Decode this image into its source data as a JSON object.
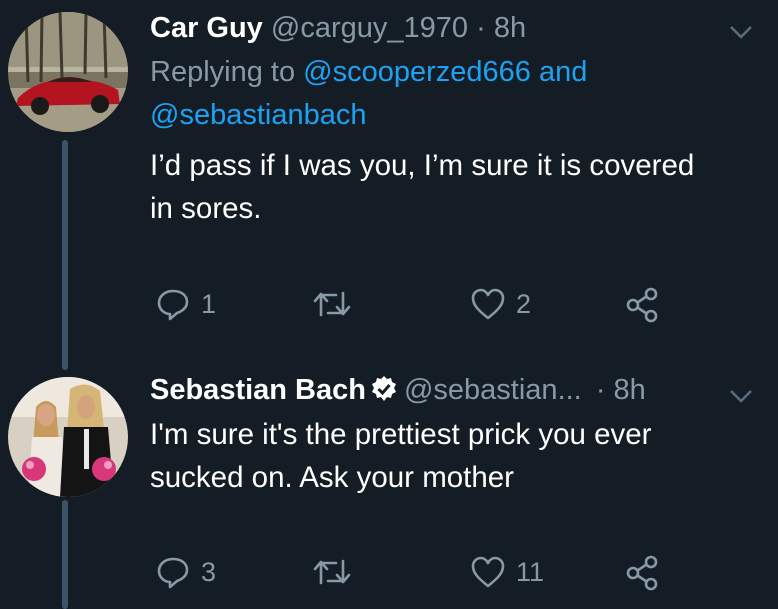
{
  "tweets": [
    {
      "name": "Car Guy",
      "handle": "@carguy_1970",
      "separator": "·",
      "time": "8h",
      "replying_prefix": "Replying to",
      "reply_user1": "@scooperzed666",
      "reply_and": "and",
      "reply_user2": "@sebastianbach",
      "text_line1": "I’d pass if I was you, I’m sure it is covered",
      "text_line2": "in sores.",
      "reply_count": "1",
      "retweet_count": "",
      "like_count": "2",
      "avatar_icon": "red-sports-car-photo"
    },
    {
      "name": "Sebastian Bach",
      "verified": true,
      "handle": "@sebastian...",
      "separator": "·",
      "time": "8h",
      "text_line1": "I'm sure it's the prettiest prick you ever",
      "text_line2": "sucked on. Ask your mother",
      "reply_count": "3",
      "retweet_count": "",
      "like_count": "11",
      "avatar_icon": "couple-photo"
    }
  ],
  "icons": {
    "reply": "reply-icon",
    "retweet": "retweet-icon",
    "like": "heart-icon",
    "share": "share-icon",
    "caret": "chevron-down-icon",
    "verified": "verified-badge-icon"
  },
  "colors": {
    "background": "#141d26",
    "text": "#ffffff",
    "muted": "#8899a6",
    "link": "#1da1f2",
    "thread_line": "#3d5466"
  }
}
